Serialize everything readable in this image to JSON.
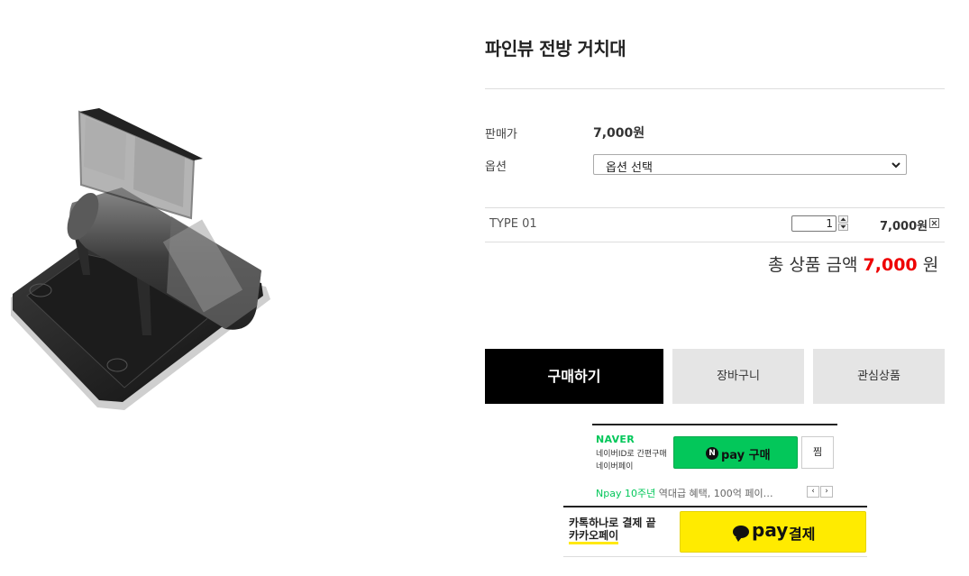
{
  "product": {
    "title": "파인뷰 전방 거치대",
    "image_alt": "product-photo-mount"
  },
  "info": {
    "price_label": "판매가",
    "price_value": "7,000원",
    "option_label": "옵션",
    "option_selected": "옵션 선택"
  },
  "selected_item": {
    "name": "TYPE 01",
    "quantity": "1",
    "price": "7,000원"
  },
  "total": {
    "prefix": "총 상품 금액",
    "amount": "7,000",
    "suffix": "원",
    "amount_color": "#ee0000"
  },
  "buttons": {
    "buy": "구매하기",
    "cart": "장바구니",
    "wish": "관심상품"
  },
  "npay": {
    "brand": "NAVER",
    "sub1": "네이버ID로 간편구매",
    "sub2": "네이버페이",
    "n_glyph": "N",
    "button_label": "pay 구매",
    "zzim": "찜",
    "promo_highlight": "Npay 10주년",
    "promo_text": " 역대급 혜택, 100억 페이…",
    "prev": "‹",
    "next": "›",
    "brand_color": "#03c75a"
  },
  "kakaopay": {
    "line1": "카톡하나로 결제 끝",
    "line2": "카카오페이",
    "pay": "pay",
    "button_label": "결제",
    "brand_color": "#ffeb00"
  }
}
